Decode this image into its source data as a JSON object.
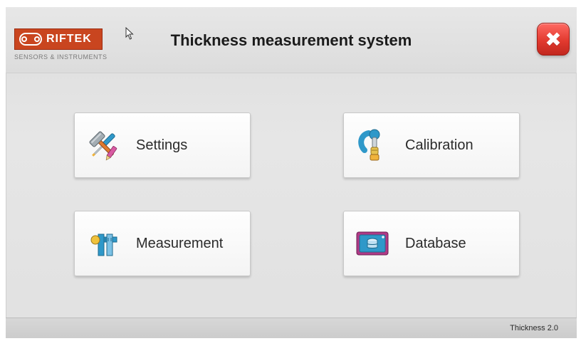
{
  "app": {
    "title": "Thickness measurement system",
    "version": "Thickness 2.0"
  },
  "logo": {
    "brand": "RIFTEK",
    "tagline": "SENSORS & INSTRUMENTS"
  },
  "header": {
    "close_icon": "close-icon",
    "close_label": "✖"
  },
  "menu": {
    "items": [
      {
        "label": "Settings",
        "icon": "tools-icon"
      },
      {
        "label": "Calibration",
        "icon": "micrometer-icon"
      },
      {
        "label": "Measurement",
        "icon": "caliper-icon"
      },
      {
        "label": "Database",
        "icon": "tablet-database-icon"
      }
    ]
  },
  "colors": {
    "brand": "#c9451f",
    "close": "#e23a2f",
    "tile_bg": "#f7f7f7",
    "accent_blue": "#2f98c9"
  }
}
